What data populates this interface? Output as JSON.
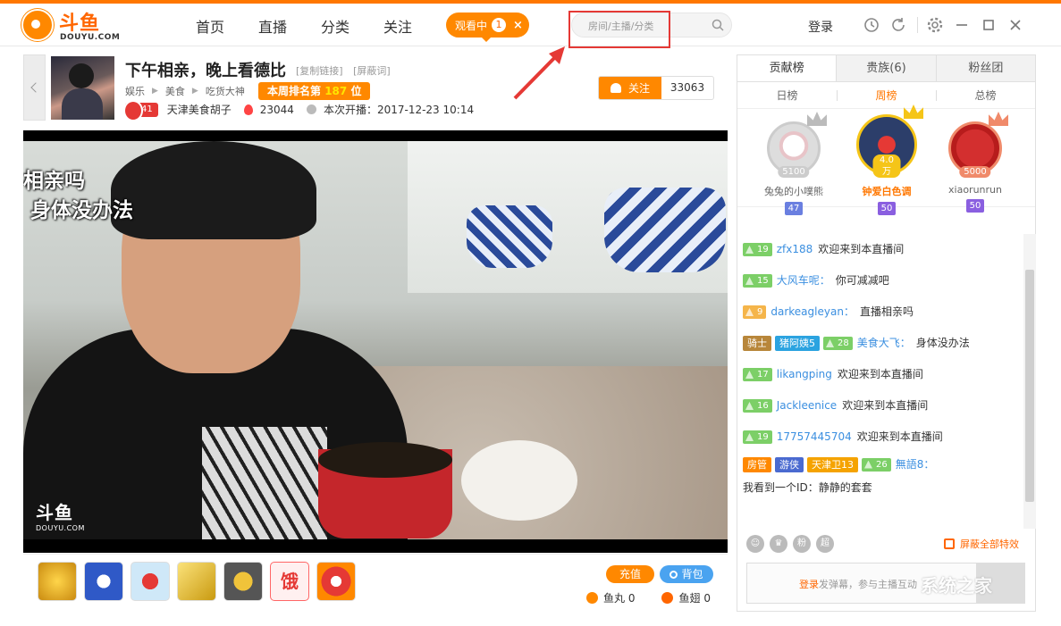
{
  "header": {
    "logo_text": "斗鱼",
    "logo_sub": "DOUYU.COM",
    "nav": [
      "首页",
      "直播",
      "分类",
      "关注"
    ],
    "watching_label": "观看中",
    "watching_count": "1",
    "watching_close": "×",
    "search_placeholder": "房间/主播/分类",
    "login": "登录"
  },
  "room": {
    "title": "下午相亲，晚上看德比",
    "copy_link": "[复制链接]",
    "block_words": "[屏蔽词]",
    "category": [
      "娱乐",
      "美食",
      "吃货大神"
    ],
    "rank_prefix": "本周排名第",
    "rank_value": "187",
    "rank_suffix": "位",
    "anchor_level": "41",
    "anchor_name": "天津美食胡子",
    "heat": "23044",
    "start_label": "本次开播：",
    "start_time": "2017-12-23 10:14",
    "follow_label": "关注",
    "follow_count": "33063"
  },
  "video": {
    "overlay_line1": "相亲吗",
    "overlay_line2": "身体没办法",
    "watermark": "斗鱼",
    "watermark_sub": "DOUYU.COM"
  },
  "giftbar": {
    "gift6_text": "饿",
    "charge": "充值",
    "bag": "背包",
    "yuwan_label": "鱼丸",
    "yuwan_value": "0",
    "yuchi_label": "鱼翅",
    "yuchi_value": "0"
  },
  "sidebar": {
    "tabs": [
      "贡献榜",
      "贵族(6)",
      "粉丝团"
    ],
    "subtabs": [
      "日榜",
      "周榜",
      "总榜"
    ],
    "active_subtab": "周榜",
    "podium": [
      {
        "rank": "2",
        "name": "兔兔的小噗熊",
        "value": "5100",
        "badges": [
          "47"
        ]
      },
      {
        "rank": "1",
        "name": "钟爱白色调",
        "value": "4.0万",
        "badges": [
          "50"
        ]
      },
      {
        "rank": "3",
        "name": "xiaorunrun",
        "value": "5000",
        "badges": [
          "50"
        ]
      }
    ],
    "chat": [
      {
        "level": "19",
        "user": "zfx188",
        "text": "欢迎来到本直播间"
      },
      {
        "level": "15",
        "user": "大风车呢：",
        "text": "你可减减吧"
      },
      {
        "level": "9",
        "user": "darkeagleyan：",
        "text": "直播相亲吗"
      },
      {
        "tags": [
          "骑士",
          "猪阿姨5"
        ],
        "level": "28",
        "user": "美食大飞：",
        "text": "身体没办法"
      },
      {
        "level": "17",
        "user": "likangping",
        "text": "欢迎来到本直播间"
      },
      {
        "level": "16",
        "user": "Jackleenice",
        "text": "欢迎来到本直播间"
      },
      {
        "level": "19",
        "user": "17757445704",
        "text": "欢迎来到本直播间"
      },
      {
        "tags": [
          "房管",
          "游侠",
          "天津卫13"
        ],
        "level": "26",
        "user": "無語8：",
        "text": "我看到一个ID：静静的套套"
      }
    ],
    "tool_icons": [
      "emoji-icon",
      "crown-icon",
      "fen-icon",
      "chao-icon"
    ],
    "tool_chars": [
      "粉",
      "超"
    ],
    "shield_label": "屏蔽全部特效",
    "input_login": "登录",
    "input_hint": "发弹幕，参与主播互动"
  },
  "watermark_corner": "系统之家",
  "colors": {
    "accent": "#ff7700",
    "alert": "#e53935",
    "link": "#3b8fe0"
  }
}
